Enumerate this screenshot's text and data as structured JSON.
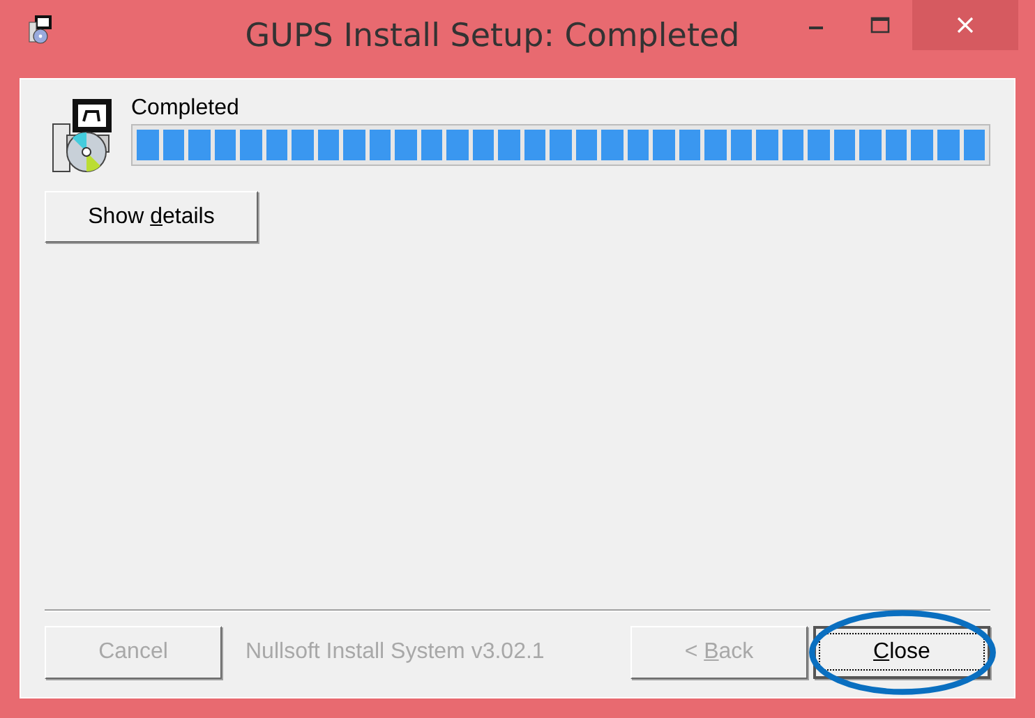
{
  "window": {
    "title": "GUPS Install Setup: Completed",
    "controls": [
      {
        "kind": "minimize",
        "hovered": false
      },
      {
        "kind": "maximize",
        "hovered": false
      },
      {
        "kind": "close",
        "hovered": true
      }
    ]
  },
  "status": {
    "text": "Completed",
    "level": 1
  },
  "details_button": {
    "parts": [
      {
        "text": "Show ",
        "accel": false
      },
      {
        "text": "d",
        "accel": true
      },
      {
        "text": "etails",
        "accel": false
      }
    ],
    "disabled": false,
    "default": false
  },
  "footer": {
    "branding": "Nullsoft Install System v3.02.1",
    "buttons": [
      {
        "parts": [
          {
            "text": "Cancel",
            "accel": false
          }
        ],
        "disabled": true,
        "default": false
      },
      {
        "parts": [
          {
            "text": "< ",
            "accel": false
          },
          {
            "text": "B",
            "accel": true
          },
          {
            "text": "ack",
            "accel": false
          }
        ],
        "disabled": true,
        "default": false
      },
      {
        "parts": [
          {
            "text": "C",
            "accel": true
          },
          {
            "text": "lose",
            "accel": false
          }
        ],
        "disabled": false,
        "default": true,
        "circled": true
      }
    ]
  }
}
